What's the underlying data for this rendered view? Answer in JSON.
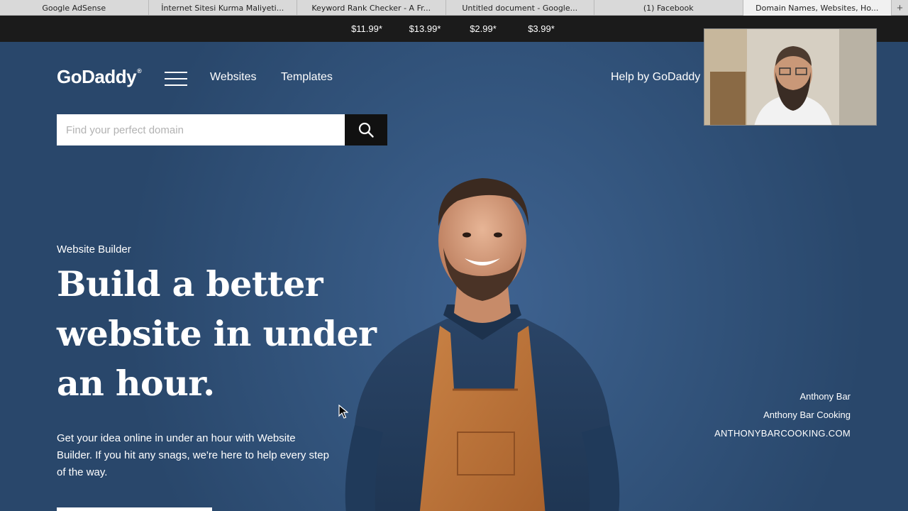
{
  "browser": {
    "tabs": [
      {
        "label": "Google AdSense"
      },
      {
        "label": "İnternet Sitesi Kurma Maliyeti..."
      },
      {
        "label": "Keyword Rank Checker - A Fr..."
      },
      {
        "label": "Untitled document - Google..."
      },
      {
        "label": "(1) Facebook"
      },
      {
        "label": "Domain Names, Websites, Ho...",
        "active": true
      }
    ],
    "new_tab_label": "+"
  },
  "promo_bar": {
    "prices": [
      "$11.99*",
      "$13.99*",
      "$2.99*",
      "$3.99*"
    ]
  },
  "header": {
    "logo_text": "GoDaddy",
    "logo_mark": "®",
    "nav": {
      "websites": "Websites",
      "templates": "Templates",
      "help": "Help by GoDaddy"
    }
  },
  "search": {
    "placeholder": "Find your perfect domain",
    "value": ""
  },
  "hero": {
    "eyebrow": "Website Builder",
    "headline_lines": [
      "Build a better",
      "website in under",
      "an hour."
    ],
    "subtext": "Get your idea online in under an hour with Website Builder. If you hit any snags, we're here to help every step of the way.",
    "credit": {
      "name": "Anthony Bar",
      "business": "Anthony Bar Cooking",
      "site": "ANTHONYBARCOOKING.COM"
    }
  },
  "colors": {
    "hero_bg": "#2f4b73",
    "apron": "#c87a3e",
    "price_bar": "#1b1b1b"
  },
  "icons": {
    "search": "search-icon",
    "menu": "hamburger-menu-icon",
    "cursor": "mouse-cursor-icon"
  }
}
